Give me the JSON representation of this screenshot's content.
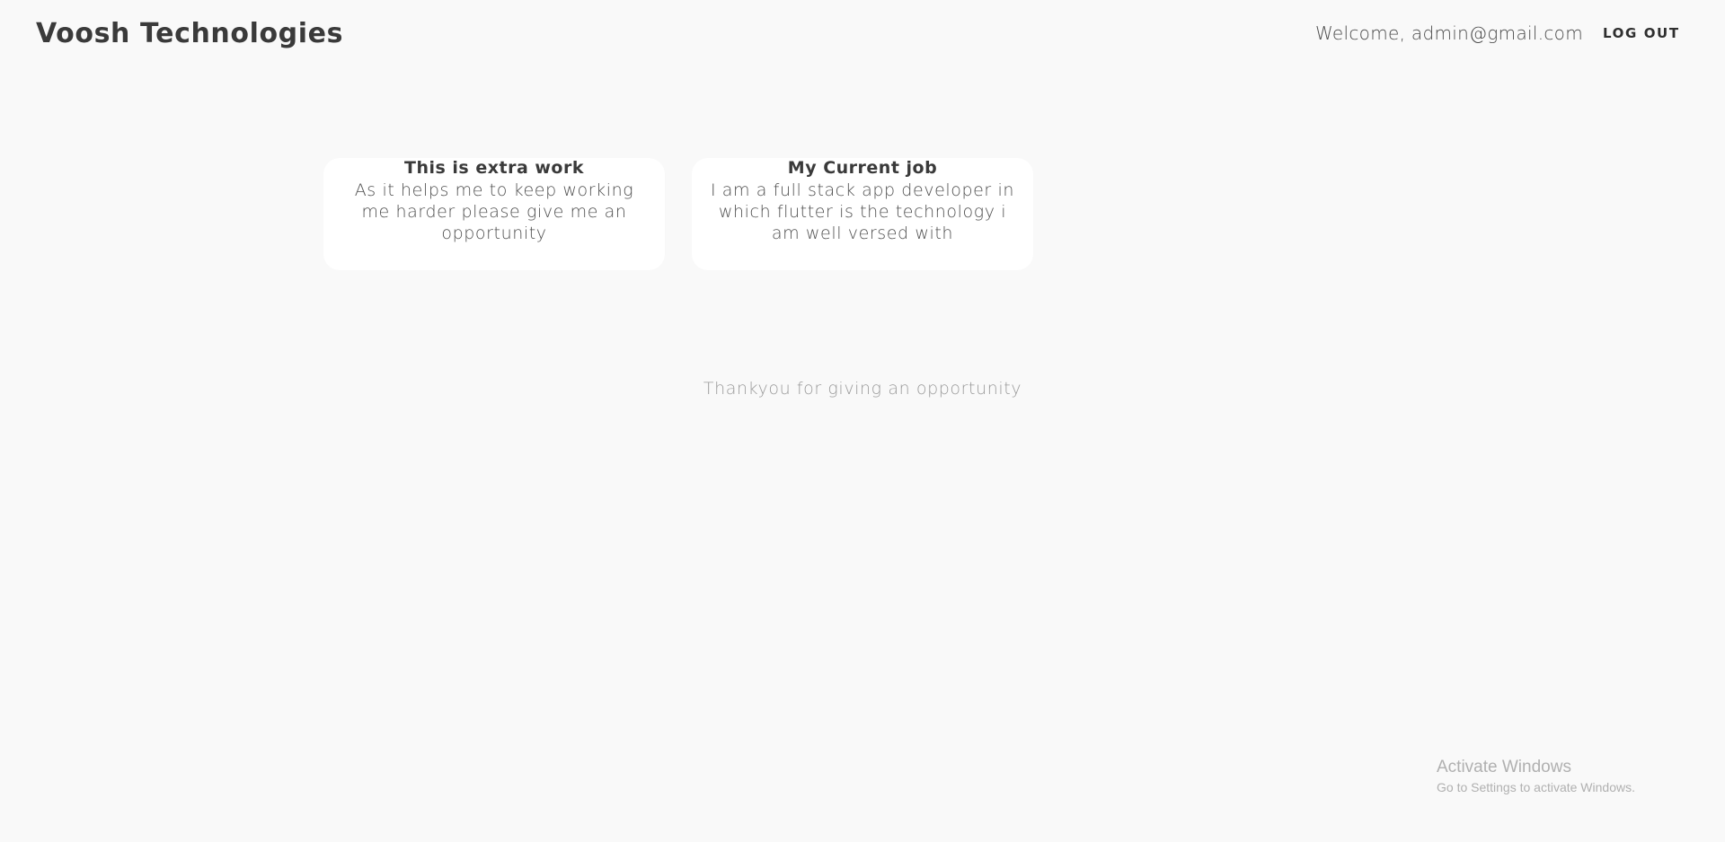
{
  "header": {
    "brand": "Voosh Technologies",
    "welcome": "Welcome, admin@gmail.com",
    "logout_label": "LOG OUT"
  },
  "cards": [
    {
      "title": "This is extra work",
      "body": "As it helps me to keep working me harder please give me an opportunity"
    },
    {
      "title": "My Current job",
      "body": "I am a full stack app developer in which flutter is the technology i am well versed with"
    }
  ],
  "footer": {
    "thanks": "Thankyou for giving an opportunity"
  },
  "watermark": {
    "title": "Activate Windows",
    "subtitle": "Go to Settings to activate Windows."
  },
  "colors": {
    "background": "#f9f9f9",
    "card": "#ffffff",
    "text": "#3a3a3a",
    "muted": "#9b9b9b"
  }
}
